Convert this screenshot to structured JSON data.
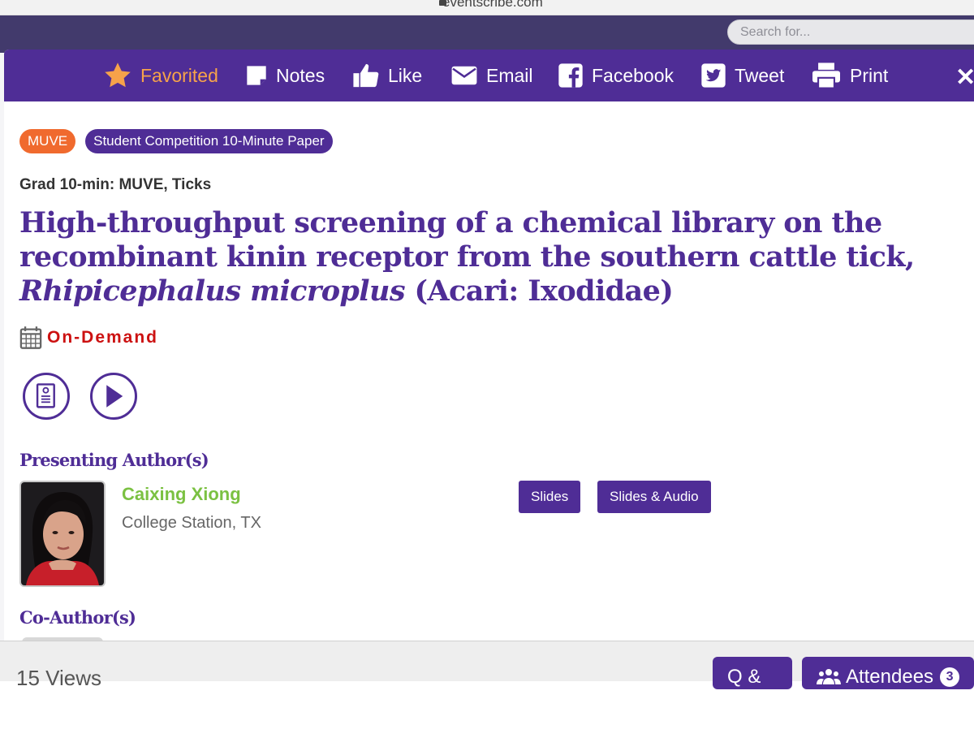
{
  "browser": {
    "url": "eventscribe.com"
  },
  "background": {
    "search_placeholder": "Search for..."
  },
  "toolbar": {
    "favorited": "Favorited",
    "notes": "Notes",
    "like": "Like",
    "email": "Email",
    "facebook": "Facebook",
    "tweet": "Tweet",
    "print": "Print",
    "close": "✕"
  },
  "tags": [
    "MUVE",
    "Student Competition 10-Minute Paper"
  ],
  "session": "Grad 10-min: MUVE, Ticks",
  "title": {
    "main": "High-throughput screening of a chemical library on the recombinant kinin receptor from the southern cattle tick, ",
    "italic": "Rhipicephalus microplus",
    "tail": " (Acari: Ixodidae)"
  },
  "schedule": "On-Demand",
  "sections": {
    "presenting": "Presenting Author(s)",
    "coauthors": "Co-Author(s)"
  },
  "presenter": {
    "name": "Caixing Xiong",
    "location": "College Station, TX"
  },
  "media_buttons": {
    "slides": "Slides",
    "slides_audio": "Slides & Audio"
  },
  "footer": {
    "views": "15 Views",
    "qa": "Q & A",
    "attendees": "Attendees",
    "attendees_count": "3"
  },
  "colors": {
    "brand_purple": "#4f2d96",
    "favorite_orange": "#f6a24a",
    "tag_orange": "#f06a2e",
    "author_green": "#7bc142",
    "ondemand_red": "#cc1111"
  }
}
